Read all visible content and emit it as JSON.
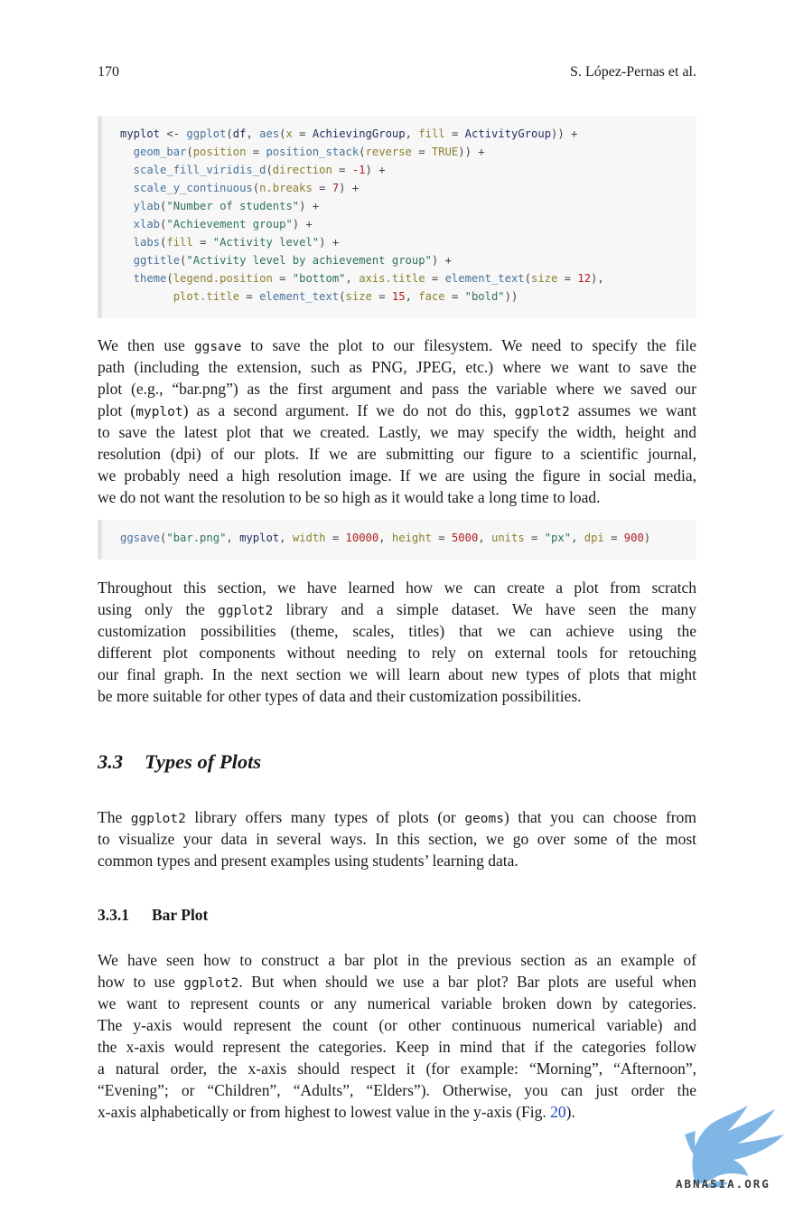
{
  "header": {
    "page_number": "170",
    "author": "S. López-Pernas et al."
  },
  "code_block_1": [
    [
      [
        "myplot",
        "kw"
      ],
      [
        " <- ",
        "op"
      ],
      [
        "ggplot",
        "fn"
      ],
      [
        "(",
        "op"
      ],
      [
        "df",
        "kw"
      ],
      [
        ", ",
        "op"
      ],
      [
        "aes",
        "fn"
      ],
      [
        "(",
        "op"
      ],
      [
        "x",
        "arg"
      ],
      [
        " = ",
        "op"
      ],
      [
        "AchievingGroup",
        "kw"
      ],
      [
        ", ",
        "op"
      ],
      [
        "fill",
        "arg"
      ],
      [
        " = ",
        "op"
      ],
      [
        "ActivityGroup",
        "kw"
      ],
      [
        ")) +",
        "op"
      ]
    ],
    [
      [
        "  geom_bar",
        "fn"
      ],
      [
        "(",
        "op"
      ],
      [
        "position",
        "arg"
      ],
      [
        " = ",
        "op"
      ],
      [
        "position_stack",
        "fn"
      ],
      [
        "(",
        "op"
      ],
      [
        "reverse",
        "arg"
      ],
      [
        " = ",
        "op"
      ],
      [
        "TRUE",
        "arg"
      ],
      [
        ")) +",
        "op"
      ]
    ],
    [
      [
        "  scale_fill_viridis_d",
        "fn"
      ],
      [
        "(",
        "op"
      ],
      [
        "direction",
        "arg"
      ],
      [
        " = ",
        "op"
      ],
      [
        "-1",
        "numc"
      ],
      [
        ") +",
        "op"
      ]
    ],
    [
      [
        "  scale_y_continuous",
        "fn"
      ],
      [
        "(",
        "op"
      ],
      [
        "n.breaks",
        "arg"
      ],
      [
        " = ",
        "op"
      ],
      [
        "7",
        "numc"
      ],
      [
        ") +",
        "op"
      ]
    ],
    [
      [
        "  ylab",
        "fn"
      ],
      [
        "(",
        "op"
      ],
      [
        "\"Number of students\"",
        "str"
      ],
      [
        ") +",
        "op"
      ]
    ],
    [
      [
        "  xlab",
        "fn"
      ],
      [
        "(",
        "op"
      ],
      [
        "\"Achievement group\"",
        "str"
      ],
      [
        ") +",
        "op"
      ]
    ],
    [
      [
        "  labs",
        "fn"
      ],
      [
        "(",
        "op"
      ],
      [
        "fill",
        "arg"
      ],
      [
        " = ",
        "op"
      ],
      [
        "\"Activity level\"",
        "str"
      ],
      [
        ") +",
        "op"
      ]
    ],
    [
      [
        "  ggtitle",
        "fn"
      ],
      [
        "(",
        "op"
      ],
      [
        "\"Activity level by achievement group\"",
        "str"
      ],
      [
        ") +",
        "op"
      ]
    ],
    [
      [
        "  theme",
        "fn"
      ],
      [
        "(",
        "op"
      ],
      [
        "legend.position",
        "arg"
      ],
      [
        " = ",
        "op"
      ],
      [
        "\"bottom\"",
        "str"
      ],
      [
        ", ",
        "op"
      ],
      [
        "axis.title",
        "arg"
      ],
      [
        " = ",
        "op"
      ],
      [
        "element_text",
        "fn"
      ],
      [
        "(",
        "op"
      ],
      [
        "size",
        "arg"
      ],
      [
        " = ",
        "op"
      ],
      [
        "12",
        "numc"
      ],
      [
        "),",
        "op"
      ]
    ],
    [
      [
        "        plot.title",
        "arg"
      ],
      [
        " = ",
        "op"
      ],
      [
        "element_text",
        "fn"
      ],
      [
        "(",
        "op"
      ],
      [
        "size",
        "arg"
      ],
      [
        " = ",
        "op"
      ],
      [
        "15",
        "numc"
      ],
      [
        ", ",
        "op"
      ],
      [
        "face",
        "arg"
      ],
      [
        " = ",
        "op"
      ],
      [
        "\"bold\"",
        "str"
      ],
      [
        "))",
        "op"
      ]
    ]
  ],
  "paragraph_1": [
    "We then use |ggsave| to save the plot to our filesystem. We need to specify the file",
    "path (including the extension, such as PNG, JPEG, etc.) where we want to save the",
    "plot (e.g., “bar.png”) as the first argument and pass the variable where we saved our",
    "plot (|myplot|) as a second argument. If we do not do this, |ggplot2| assumes we want",
    "to save the latest plot that we created. Lastly, we may specify the width, height and",
    "resolution (dpi) of our plots. If we are submitting our figure to a scientific journal,",
    "we probably need a high resolution image. If we are using the figure in social media,",
    "we do not want the resolution to be so high as it would take a long time to load."
  ],
  "code_block_2": [
    [
      [
        "ggsave",
        "fn"
      ],
      [
        "(",
        "op"
      ],
      [
        "\"bar.png\"",
        "str"
      ],
      [
        ", ",
        "op"
      ],
      [
        "myplot",
        "kw"
      ],
      [
        ", ",
        "op"
      ],
      [
        "width",
        "arg"
      ],
      [
        " = ",
        "op"
      ],
      [
        "10000",
        "numc"
      ],
      [
        ", ",
        "op"
      ],
      [
        "height",
        "arg"
      ],
      [
        " = ",
        "op"
      ],
      [
        "5000",
        "numc"
      ],
      [
        ", ",
        "op"
      ],
      [
        "units",
        "arg"
      ],
      [
        " = ",
        "op"
      ],
      [
        "\"px\"",
        "str"
      ],
      [
        ", ",
        "op"
      ],
      [
        "dpi",
        "arg"
      ],
      [
        " = ",
        "op"
      ],
      [
        "900",
        "numc"
      ],
      [
        ")",
        "op"
      ]
    ]
  ],
  "paragraph_2": [
    "Throughout this section, we have learned how we can create a plot from scratch",
    "using only the |ggplot2| library and a simple dataset. We have seen the many",
    "customization possibilities (theme, scales, titles) that we can achieve using the",
    "different plot components without needing to rely on external tools for retouching",
    "our final graph. In the next section we will learn about new types of plots that might",
    "be more suitable for other types of data and their customization possibilities."
  ],
  "section": {
    "number": "3.3",
    "title": "Types of Plots"
  },
  "paragraph_3": [
    "The |ggplot2| library offers many types of plots (or |geoms|) that you can choose from",
    "to visualize your data in several ways. In this section, we go over some of the most",
    "common types and present examples using students’ learning data."
  ],
  "subsection": {
    "number": "3.3.1",
    "title": "Bar Plot"
  },
  "paragraph_4": [
    "We have seen how to construct a bar plot in the previous section as an example of",
    "how to use |ggplot2|. But when should we use a bar plot? Bar plots are useful when",
    "we want to represent counts or any numerical variable broken down by categories.",
    "The y-axis would represent the count (or other continuous numerical variable) and",
    "the x-axis would represent the categories. Keep in mind that if the categories follow",
    "a natural order, the x-axis should respect it (for example: “Morning”, “Afternoon”,",
    "“Evening”; or “Children”, “Adults”, “Elders”). Otherwise, you can just order the",
    "x-axis alphabetically or from highest to lowest value in the y-axis (Fig. ^20^)."
  ],
  "watermark": {
    "text": "ABNASIA.ORG",
    "icon": "dragon-logo-icon",
    "color": "#7fb6e6"
  }
}
